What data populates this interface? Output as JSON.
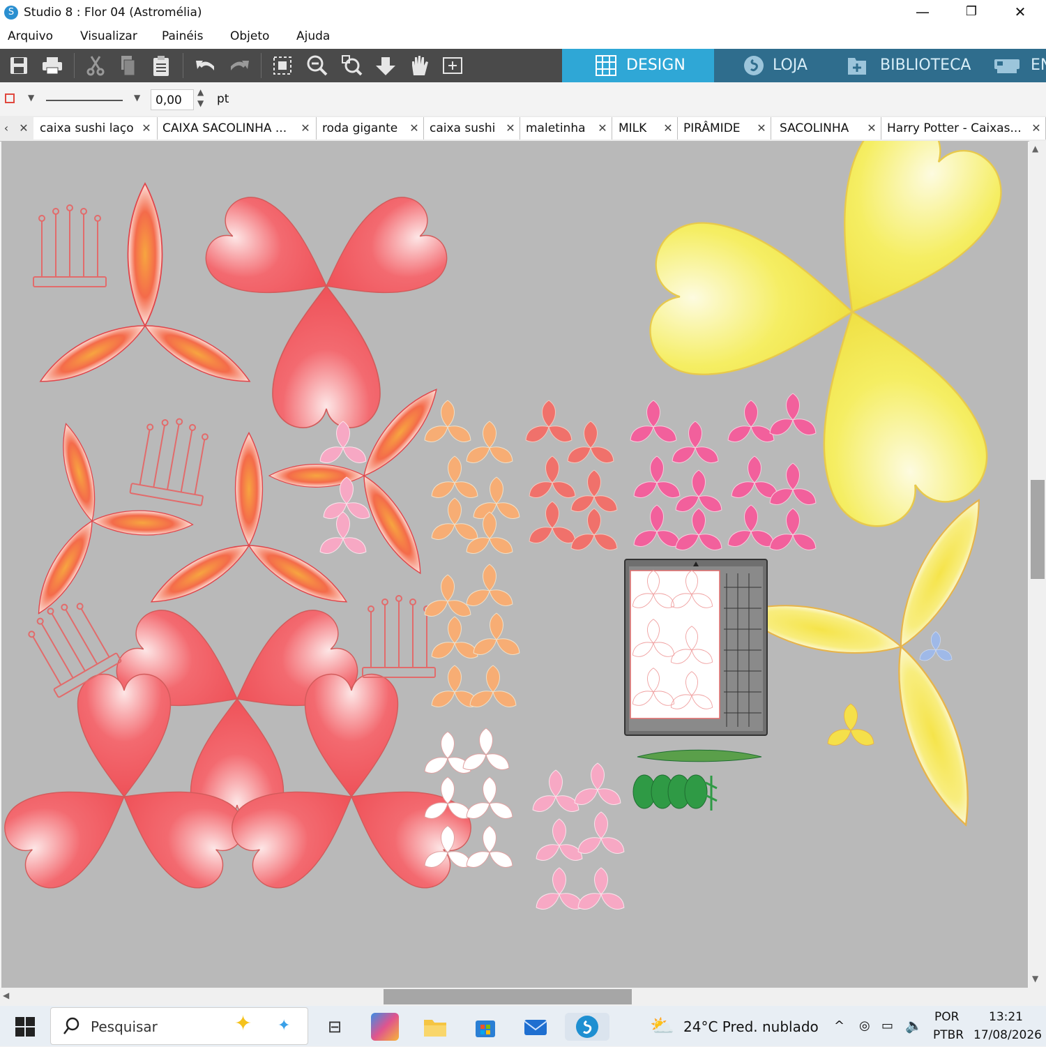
{
  "window": {
    "title": "Studio 8 : Flor 04 (Astromélia)",
    "minimize": "—",
    "restore": "❐",
    "close": "✕",
    "icon": "S"
  },
  "menu": [
    "Arquivo",
    "Visualizar",
    "Painéis",
    "Objeto",
    "Ajuda"
  ],
  "nav_tabs": {
    "design": "DESIGN",
    "store": "LOJA",
    "library": "BIBLIOTECA",
    "send": "EN"
  },
  "line_props": {
    "width_value": "0,00",
    "unit": "pt"
  },
  "doc_tabs": [
    "caixa sushi laço",
    "CAIXA SACOLINHA ...",
    "roda gigante",
    "caixa sushi",
    "maletinha",
    "MILK",
    "PIRÂMIDE",
    "SACOLINHA",
    "Harry Potter - Caixas..."
  ],
  "taskbar": {
    "search_placeholder": "Pesquisar",
    "weather": "24°C  Pred. nublado",
    "lang_top": "POR",
    "lang_bottom": "PTBR",
    "time": "13:21",
    "date": "17/08/2026"
  },
  "colors": {
    "accent": "#2fa7d6",
    "toolbar": "#4a4a4a",
    "canvas": "#b9b9b9",
    "petal_red": "#f0636a",
    "petal_orange": "#f7a35c",
    "petal_yellow": "#f2e64a",
    "petal_pink": "#f06aa8",
    "leaf_green": "#2f9a45"
  }
}
